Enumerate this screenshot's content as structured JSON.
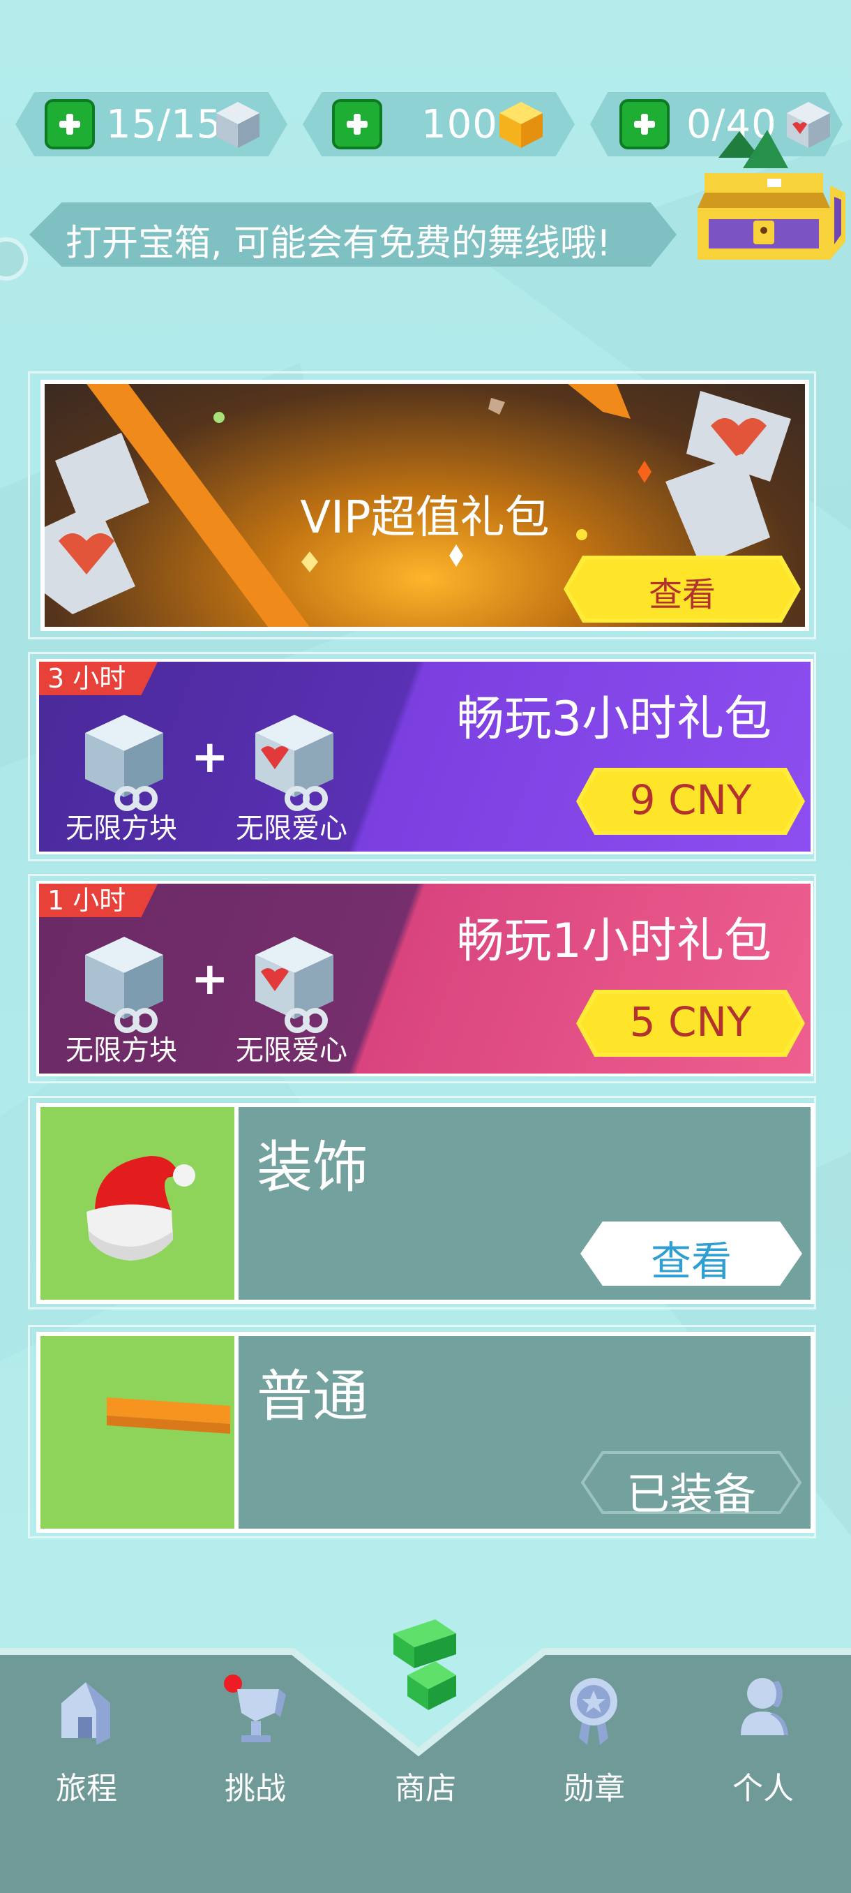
{
  "resources": [
    {
      "label": "15/15",
      "icon": "cube-icon"
    },
    {
      "label": "100",
      "icon": "gold-cube-icon"
    },
    {
      "label": "0/40",
      "icon": "heart-cube-icon"
    }
  ],
  "tip": {
    "text": "打开宝箱, 可能会有免费的舞线哦!"
  },
  "vip": {
    "title": "VIP超值礼包",
    "button": "查看"
  },
  "packs": [
    {
      "tag": "3 小时",
      "title": "畅玩3小时礼包",
      "item1": "无限方块",
      "item2": "无限爱心",
      "plus": "+",
      "price": "9 CNY"
    },
    {
      "tag": "1 小时",
      "title": "畅玩1小时礼包",
      "item1": "无限方块",
      "item2": "无限爱心",
      "plus": "+",
      "price": "5 CNY"
    }
  ],
  "shop": [
    {
      "name": "装饰",
      "button": "查看"
    },
    {
      "name": "普通",
      "button": "已装备"
    }
  ],
  "nav": [
    {
      "label": "旅程",
      "icon": "house-icon"
    },
    {
      "label": "挑战",
      "icon": "trophy-icon"
    },
    {
      "label": "商店",
      "icon": "shop-icon"
    },
    {
      "label": "勋章",
      "icon": "medal-icon"
    },
    {
      "label": "个人",
      "icon": "person-icon"
    }
  ],
  "colors": {
    "green": "#1fae34",
    "yellow": "#ffe52a",
    "purple": "#6a34c9",
    "pink": "#e04f8c",
    "nav": "#6f9a98"
  }
}
